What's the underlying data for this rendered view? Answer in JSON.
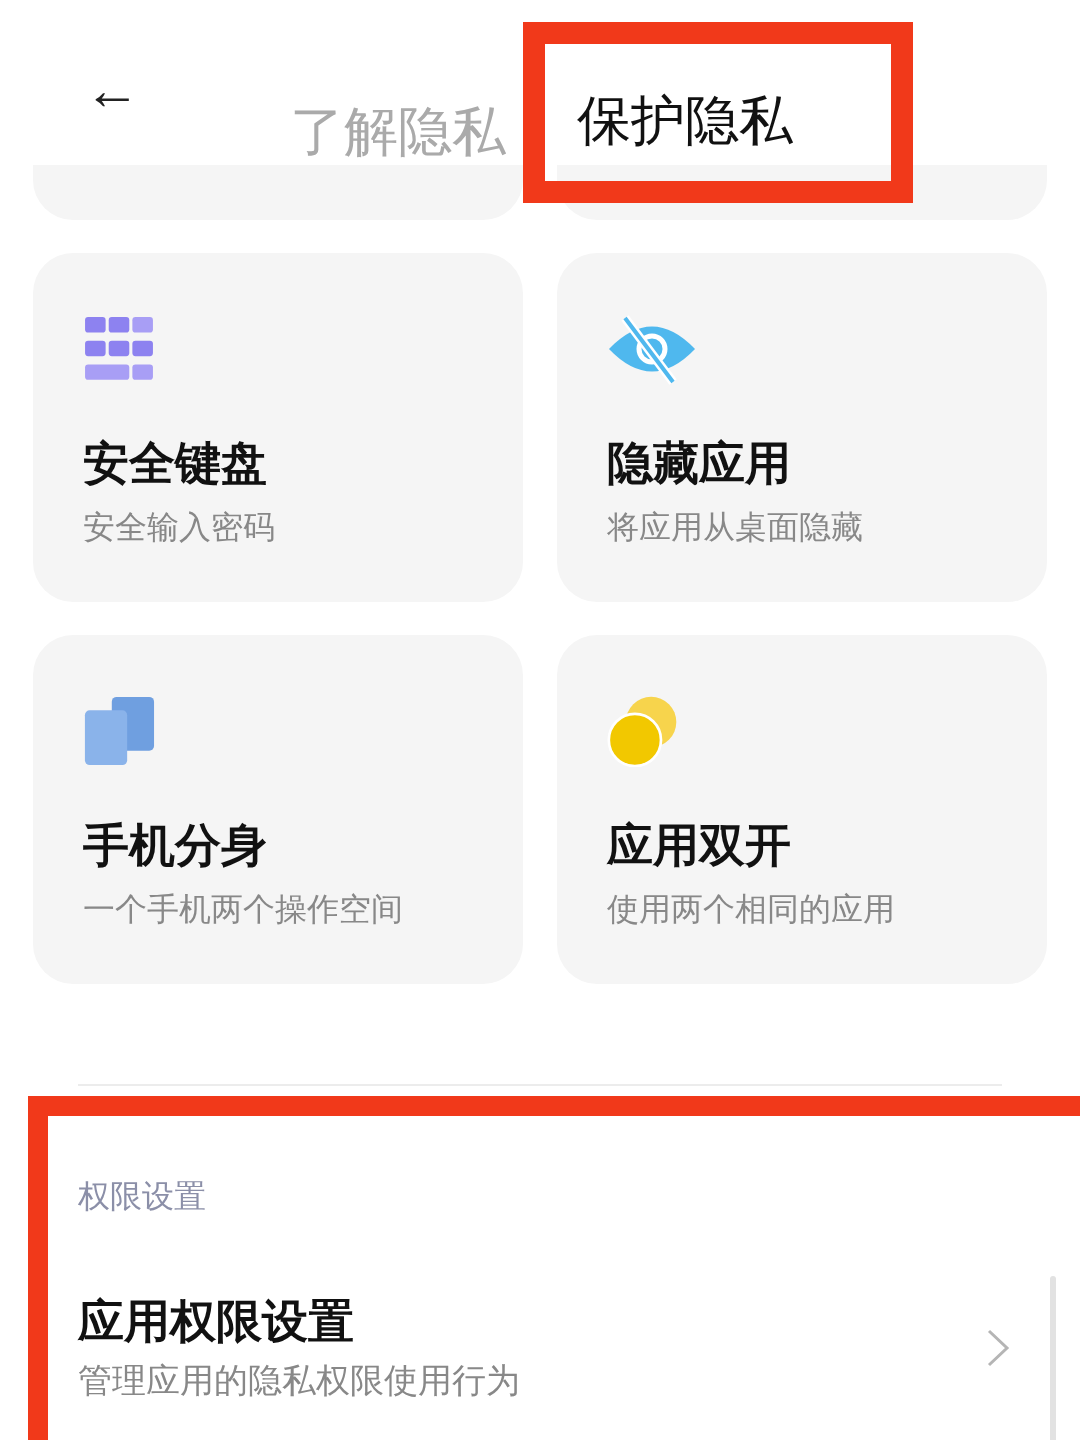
{
  "header": {
    "back": "←",
    "tabs": [
      {
        "label": "了解隐私",
        "selected": false,
        "highlighted": false
      },
      {
        "label": "保护隐私",
        "selected": true,
        "highlighted": true
      }
    ]
  },
  "cards": [
    {
      "kind": "keyboard",
      "title": "安全键盘",
      "subtitle": "安全输入密码"
    },
    {
      "kind": "hide",
      "title": "隐藏应用",
      "subtitle": "将应用从桌面隐藏"
    },
    {
      "kind": "space",
      "title": "手机分身",
      "subtitle": "一个手机两个操作空间"
    },
    {
      "kind": "dual",
      "title": "应用双开",
      "subtitle": "使用两个相同的应用"
    }
  ],
  "section": {
    "title": "权限设置",
    "highlighted": true,
    "items": [
      {
        "title": "应用权限设置",
        "subtitle": "管理应用的隐私权限使用行为"
      }
    ]
  }
}
